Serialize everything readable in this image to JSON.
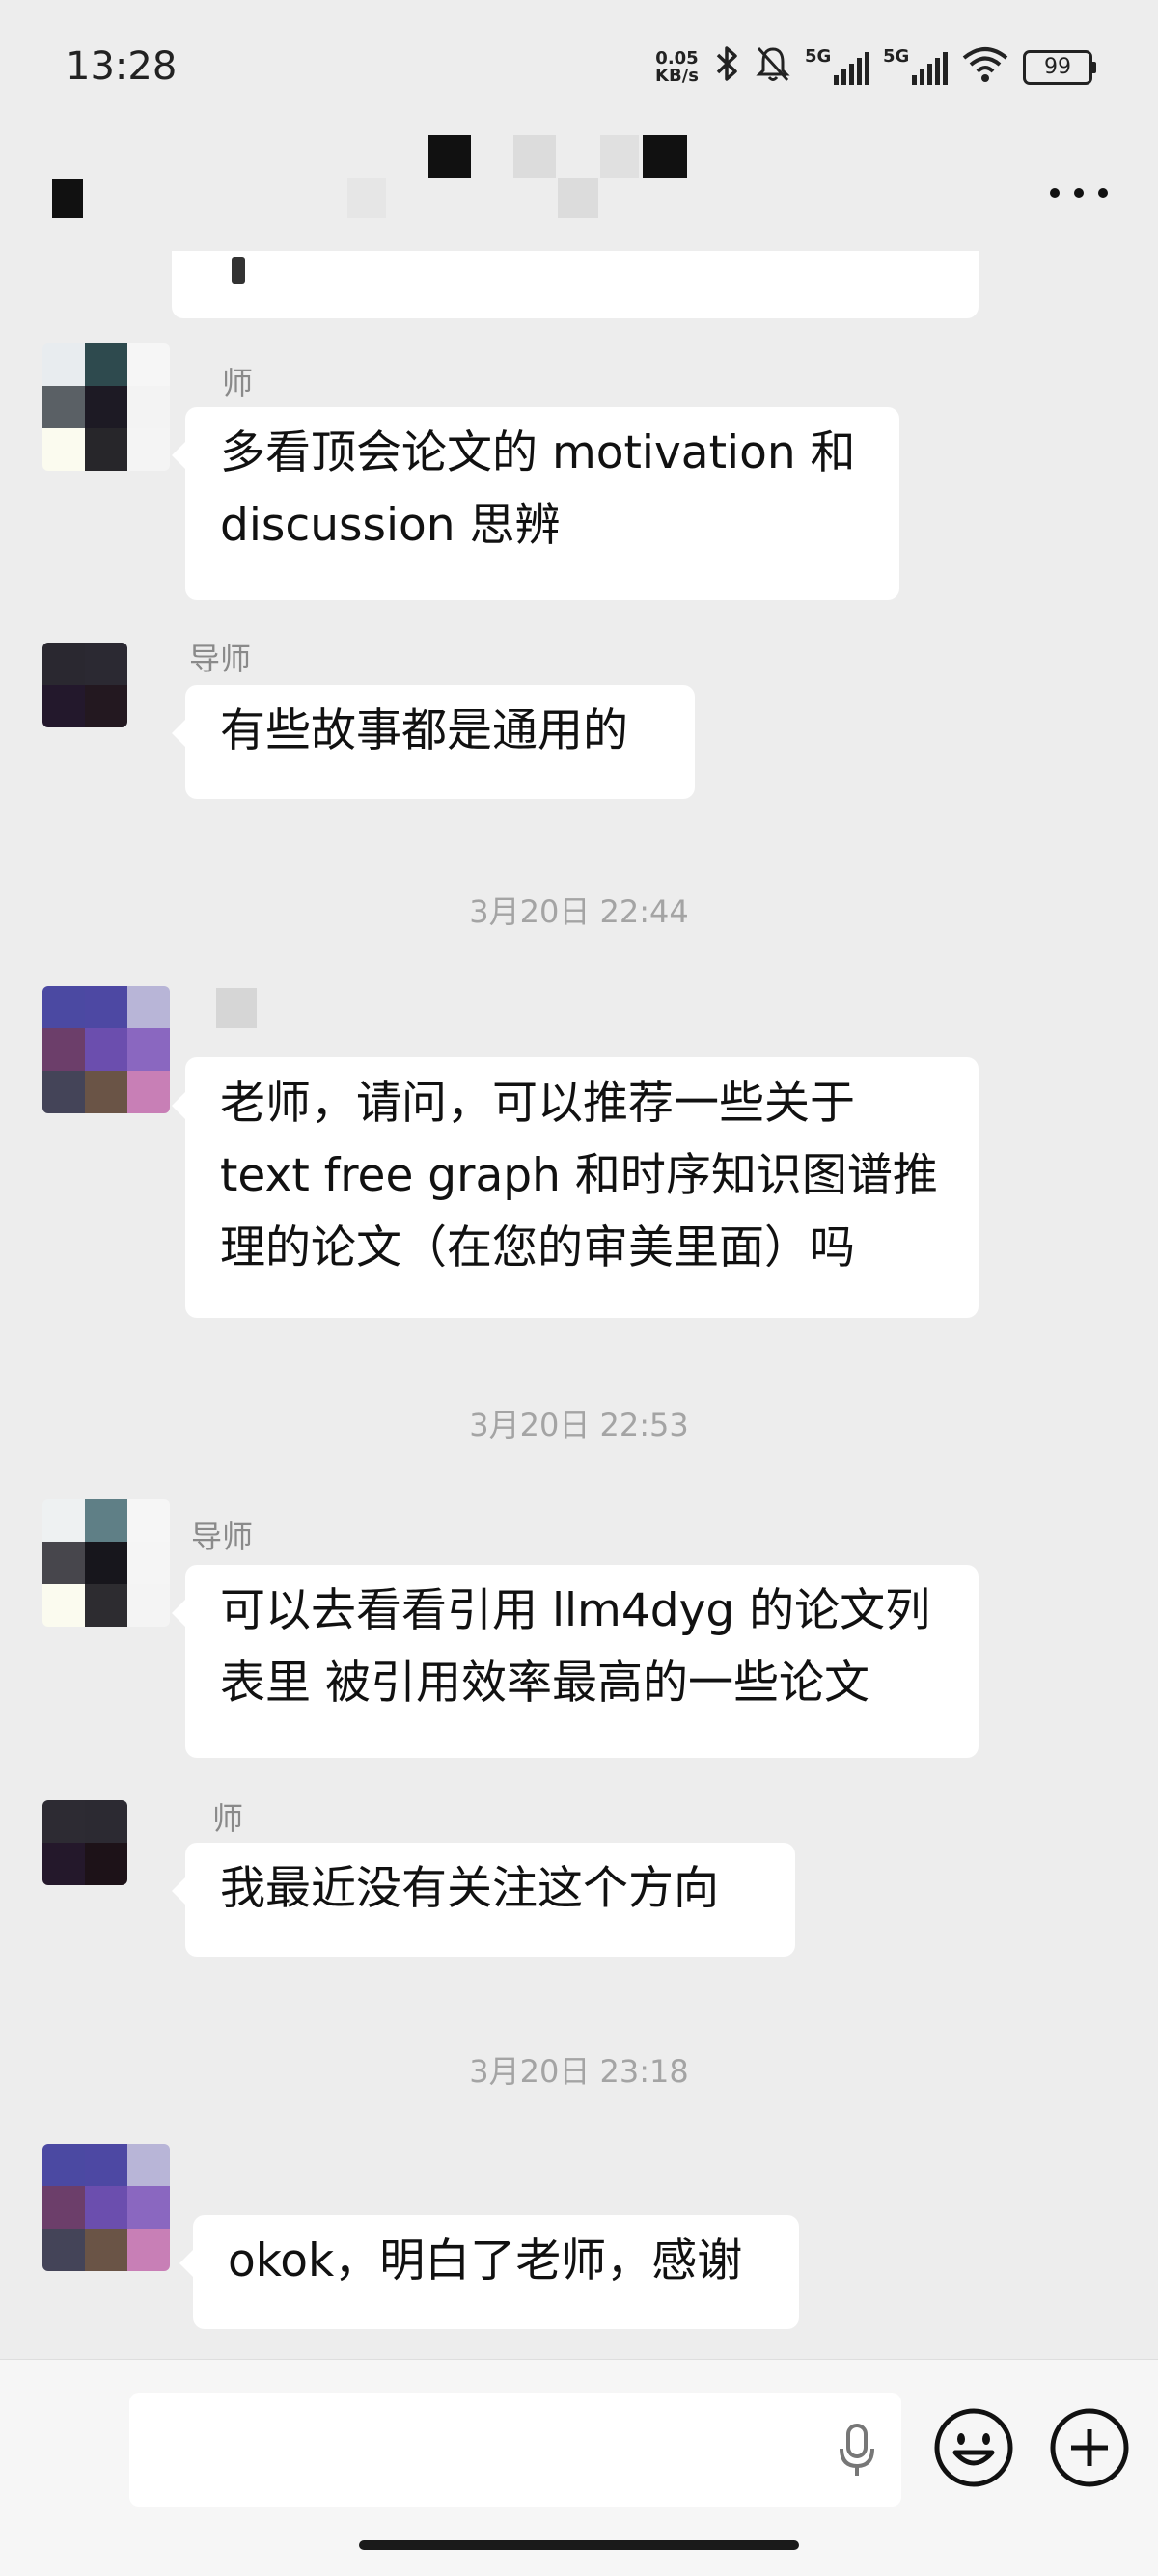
{
  "status_bar": {
    "time": "13:28",
    "net_speed_value": "0.05",
    "net_speed_unit": "KB/s",
    "sim1_label": "5G",
    "sim2_label": "5G",
    "battery": "99"
  },
  "header": {
    "icons": {
      "back": "back-arrow-icon",
      "more": "more-dots-icon"
    }
  },
  "messages": [
    {
      "sender": "师",
      "text": "多看顶会论文的 motivation 和\ndiscussion 思辨"
    },
    {
      "sender": "导师",
      "text": "有些故事都是通用的"
    },
    {
      "text": "老师，请问，可以推荐一些关于\ntext free graph 和时序知识图谱推\n理的论文（在您的审美里面）吗"
    },
    {
      "sender": "导师",
      "text": "可以去看看引用 llm4dyg 的论文列\n表里 被引用效率最高的一些论文"
    },
    {
      "sender": "师",
      "text": "我最近没有关注这个方向"
    },
    {
      "text": "okok，明白了老师，感谢"
    }
  ],
  "timestamps": [
    "3月20日 22:44",
    "3月20日 22:53",
    "3月20日 23:18"
  ],
  "input_bar": {
    "icons": {
      "mic": "microphone-icon",
      "emoji": "emoji-icon",
      "plus": "plus-icon"
    }
  }
}
